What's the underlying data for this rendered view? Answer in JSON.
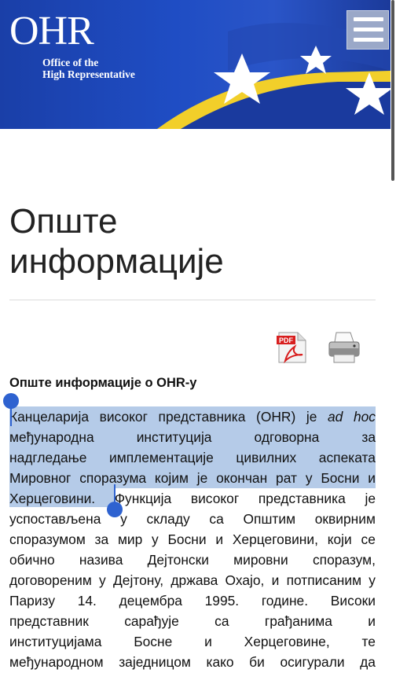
{
  "header": {
    "logo_main": "OHR",
    "logo_line1": "Office of the",
    "logo_line2": "High Representative",
    "menu_icon": "hamburger-menu-icon"
  },
  "page": {
    "title_line1": "Опште",
    "title_line2": "информације"
  },
  "toolbar": {
    "pdf_icon": "pdf-icon",
    "print_icon": "printer-icon"
  },
  "article": {
    "heading": "Опште информације о OHR-у",
    "lines": [
      [
        "Канцеларија",
        "високог",
        "представника",
        "(OHR)",
        "је",
        "ad",
        "hoc"
      ],
      [
        "међународна",
        "институција",
        "одговорна",
        "за"
      ],
      [
        "надгледање",
        "имплементације",
        "цивилних",
        "аспеката"
      ],
      [
        "Мировног",
        "споразума",
        "којим",
        "је",
        "окончан",
        "рат",
        "у",
        "Босни",
        "и"
      ],
      [
        "Херцеговини.",
        "Функција",
        "високог",
        "представника",
        "је"
      ],
      [
        "успостављена",
        "у",
        "складу",
        "са",
        "Општим",
        "оквирним"
      ],
      [
        "споразумом",
        "за",
        "мир",
        "у",
        "Босни",
        "и",
        "Херцеговини,",
        "који",
        "се"
      ],
      [
        "обично",
        "назива",
        "Дејтонски",
        "мировни",
        "споразум,"
      ],
      [
        "договореним",
        "у",
        "Дејтону,",
        "држава",
        "Охајо,",
        "и",
        "потписаним",
        "у"
      ],
      [
        "Паризу",
        "14.",
        "децембра",
        "1995.",
        "године.",
        "Високи"
      ],
      [
        "представник",
        "сарађује",
        "са",
        "грађанима",
        "и"
      ],
      [
        "институцијама",
        "Босне",
        "и",
        "Херцеговине,",
        "те"
      ],
      [
        "међународном",
        "заједницом",
        "како",
        "би",
        "осигурали",
        "да"
      ]
    ]
  },
  "colors": {
    "header_blue": "#1f4dc4",
    "selection": "#b5cbe8",
    "handle": "#2e62d0"
  }
}
